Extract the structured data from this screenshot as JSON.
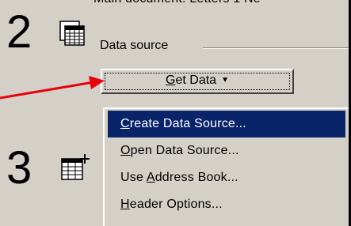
{
  "cut_off_text": "Main document: Letters 1 Ne",
  "steps": {
    "step2_number": "2",
    "step3_number": "3"
  },
  "data_source": {
    "section_label": "Data source",
    "get_data_button": {
      "mnemonic": "G",
      "rest": "et Data",
      "caret": "▼"
    }
  },
  "menu": {
    "items": [
      {
        "mnemonic": "C",
        "rest": "reate Data Source...",
        "selected": true
      },
      {
        "mnemonic": "O",
        "rest": "pen Data Source...",
        "selected": false
      },
      {
        "before": "Use ",
        "mnemonic": "A",
        "rest": "ddress Book...",
        "selected": false
      },
      {
        "mnemonic": "H",
        "rest": "eader Options...",
        "selected": false
      }
    ]
  },
  "colors": {
    "panel_bg": "#d4d0c8",
    "selection_bg": "#0a246a",
    "arrow": "#e8000a"
  },
  "icons": [
    "data-sheet-icon",
    "merge-sheet-icon"
  ]
}
